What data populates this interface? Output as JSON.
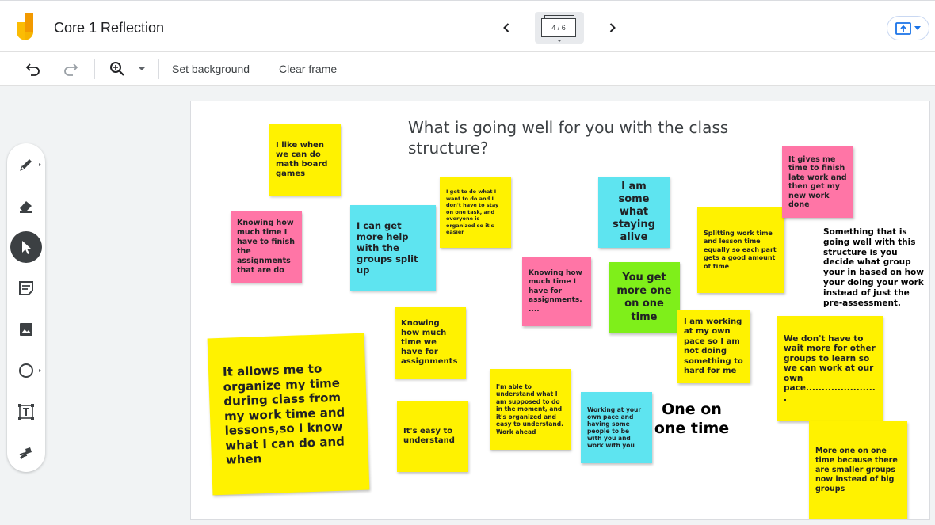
{
  "app": {
    "title": "Core 1 Reflection",
    "frame_indicator": "4 / 6"
  },
  "toolbar": {
    "set_background": "Set background",
    "clear_frame": "Clear frame"
  },
  "board": {
    "title": "What is going well for you with the class structure?",
    "notes": {
      "board_games": "I like when we can do math board games",
      "knowing_finish": "Knowing how much time I have to finish the assignments that are do",
      "more_help": "I can get more help with the groups split up",
      "want_to_do": "I get to do what I want to do and I don't have to stay on one task, and everyone is organized  so it's easier",
      "staying_alive": "I am some what staying alive",
      "knowing_assignments_pink": "Knowing how much time I have for assignments.....",
      "one_on_one_green": "You get more one on one time",
      "splitting_work": "Splitting work time and lesson time equally so each part gets a good amount of time",
      "late_work": "It gives me time to finish late work and then get my new work done",
      "organize_time": "It allows me to organize my time during class from my work time and lessons,so I know what I can do and when",
      "knowing_assignments_yellow": "Knowing how much time we have for assignments",
      "own_pace": "I am working at my own pace so I am not doing something to hard for me",
      "wait_more": "We don't have to wait more for other groups to learn so we can work at our own pace.......................",
      "easy_understand": "It's easy to understand",
      "able_understand": "I'm able to understand what I am supposed to do in the moment, and it's organized and easy to understand. Work ahead",
      "working_pace_cyan": "Working at your own pace and having some people to be with you and work with you",
      "smaller_groups": "More one on one time because there are smaller groups now instead of big groups"
    },
    "text": {
      "something_going_well": "Something that is going well with this structure is you decide what group your in based on how your doing your work instead of just the pre-assessment.",
      "one_on_one_time": "One on one time"
    }
  },
  "colors": {
    "yellow_note": "#fff200",
    "pink_note": "#ff75a6",
    "cyan_note": "#5ee4f0",
    "green_note": "#7fef1a",
    "accent": "#1a73e8"
  },
  "icons": {
    "logo": "jamboard-logo",
    "prev": "chevron-left-icon",
    "next": "chevron-right-icon",
    "share": "upload-icon",
    "undo": "undo-icon",
    "redo": "redo-icon",
    "zoom": "zoom-icon"
  }
}
